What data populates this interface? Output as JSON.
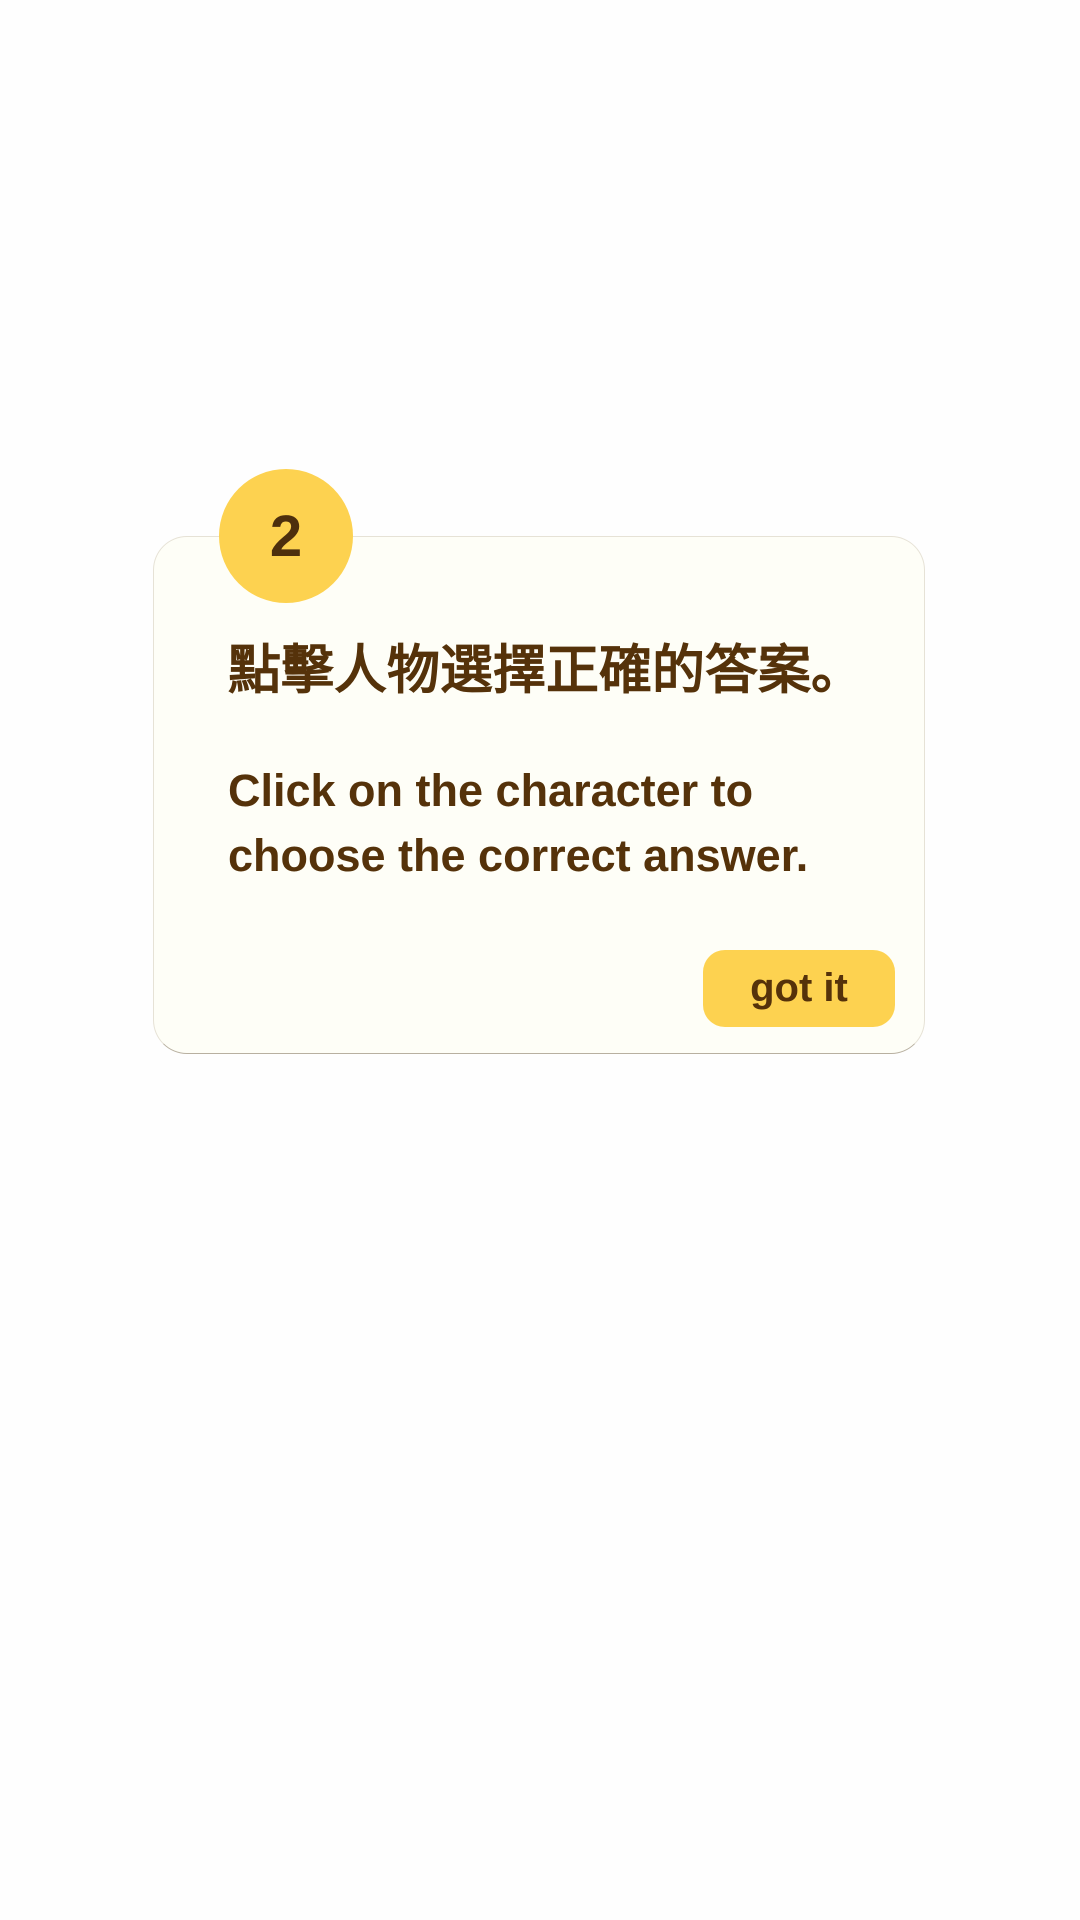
{
  "tutorial": {
    "step_number": "2",
    "instruction_zh": "點擊人物選擇正確的答案。",
    "instruction_en": "Click on the character to choose the correct answer.",
    "confirm_label": "got it"
  },
  "colors": {
    "accent": "#fdd250",
    "text": "#55320a",
    "card": "#fefef7"
  }
}
